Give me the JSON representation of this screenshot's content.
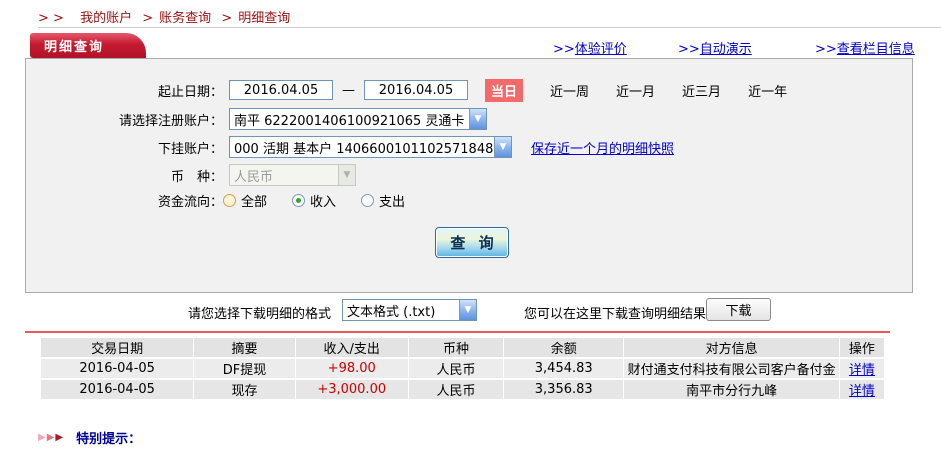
{
  "breadcrumb": {
    "prefix": "> >",
    "separator": ">",
    "items": [
      "我的账户",
      "账务查询",
      "明细查询"
    ]
  },
  "panel": {
    "tab_title": "明细查询",
    "links": [
      {
        "prefix": ">>",
        "label": "体验评价"
      },
      {
        "prefix": ">>",
        "label": "自动演示"
      },
      {
        "prefix": ">>",
        "label": "查看栏目信息"
      }
    ]
  },
  "form": {
    "date_range": {
      "label": "起止日期：",
      "start": "2016.04.05",
      "dash": "—",
      "end": "2016.04.05"
    },
    "today_button": "当日",
    "quick_ranges": [
      "近一周",
      "近一月",
      "近三月",
      "近一年"
    ],
    "registered_account": {
      "label": "请选择注册账户：",
      "value": "南平 6222001406100921065 灵通卡"
    },
    "sub_account": {
      "label": "下挂账户：",
      "value": "000 活期 基本户 1406600101102571848",
      "snapshot_link": "保存近一个月的明细快照"
    },
    "currency": {
      "label": "币　种：",
      "value": "人民币"
    },
    "flow": {
      "label": "资金流向：",
      "options": [
        {
          "label": "全部",
          "selected": false
        },
        {
          "label": "收入",
          "selected": true
        },
        {
          "label": "支出",
          "selected": false
        }
      ]
    },
    "query_button": "查 询"
  },
  "download": {
    "format_label": "请您选择下载明细的格式",
    "format_value": "文本格式 (.txt)",
    "hint": "您可以在这里下载查询明细结果",
    "button": "下载"
  },
  "table": {
    "headers": [
      "交易日期",
      "摘要",
      "收入/支出",
      "币种",
      "余额",
      "对方信息",
      "操作"
    ],
    "rows": [
      {
        "date": "2016-04-05",
        "summary": "DF提现",
        "amount": "+98.00",
        "currency": "人民币",
        "balance": "3,454.83",
        "counterparty": "财付通支付科技有限公司客户备付金",
        "action": "详情"
      },
      {
        "date": "2016-04-05",
        "summary": "现存",
        "amount": "+3,000.00",
        "currency": "人民币",
        "balance": "3,356.83",
        "counterparty": "南平市分行九峰",
        "action": "详情"
      }
    ]
  },
  "footer": {
    "notice": "特别提示："
  },
  "colors": {
    "brand_red": "#b5122a",
    "link_blue": "#0000cc",
    "amount_red": "#cc0000",
    "today_bg": "#f36a6a",
    "notice_blue": "#000099",
    "panel_bg": "#f1f1f1"
  }
}
